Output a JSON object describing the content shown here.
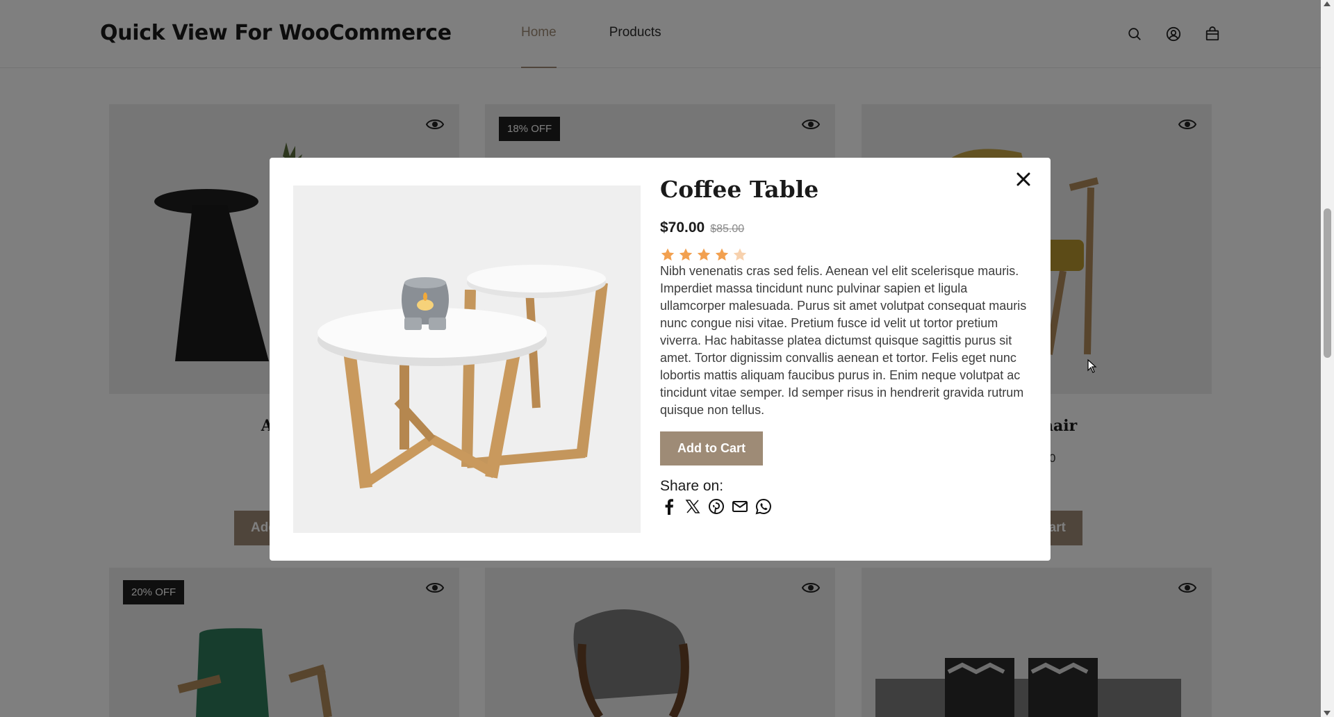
{
  "header": {
    "site_title": "Quick View For WooCommerce",
    "nav": [
      {
        "label": "Home",
        "active": true
      },
      {
        "label": "Products",
        "active": false
      }
    ],
    "icons": [
      "search-icon",
      "account-icon",
      "cart-icon"
    ]
  },
  "grid": {
    "row1": [
      {
        "title": "Abstr",
        "price": "$",
        "button": "Add",
        "badge": "",
        "icon": "eye-icon"
      },
      {
        "title": "",
        "price": "",
        "button": "",
        "badge": "18% OFF",
        "icon": "eye-icon"
      },
      {
        "title": "hair",
        "price": "0",
        "button": "cart",
        "badge": "",
        "icon": "eye-icon"
      }
    ],
    "row2": [
      {
        "badge": "20% OFF",
        "icon": "eye-icon"
      },
      {
        "badge": "",
        "icon": "eye-icon"
      },
      {
        "badge": "",
        "icon": "eye-icon"
      }
    ]
  },
  "modal": {
    "title": "Coffee Table",
    "price": "$70.00",
    "old_price": "$85.00",
    "rating": 4,
    "rating_max": 5,
    "description": "Nibh venenatis cras sed felis. Aenean vel elit scelerisque mauris. Imperdiet massa tincidunt nunc pulvinar sapien et ligula ullamcorper malesuada. Purus sit amet volutpat consequat mauris nunc congue nisi vitae. Pretium fusce id velit ut tortor pretium viverra. Hac habitasse platea dictumst quisque sagittis purus sit amet. Tortor dignissim convallis aenean et tortor. Felis eget nunc lobortis mattis aliquam faucibus purus in. Enim neque volutpat ac tincidunt vitae semper. Id semper risus in hendrerit gravida rutrum quisque non tellus.",
    "add_to_cart": "Add to Cart",
    "share_label": "Share on:",
    "share_icons": [
      "facebook-icon",
      "x-icon",
      "pinterest-icon",
      "email-icon",
      "whatsapp-icon"
    ]
  },
  "colors": {
    "accent": "#9e8b76",
    "star": "#f2a04f",
    "star_empty": "#f7d1ad",
    "overlay": "rgba(0,0,0,0.5)"
  }
}
